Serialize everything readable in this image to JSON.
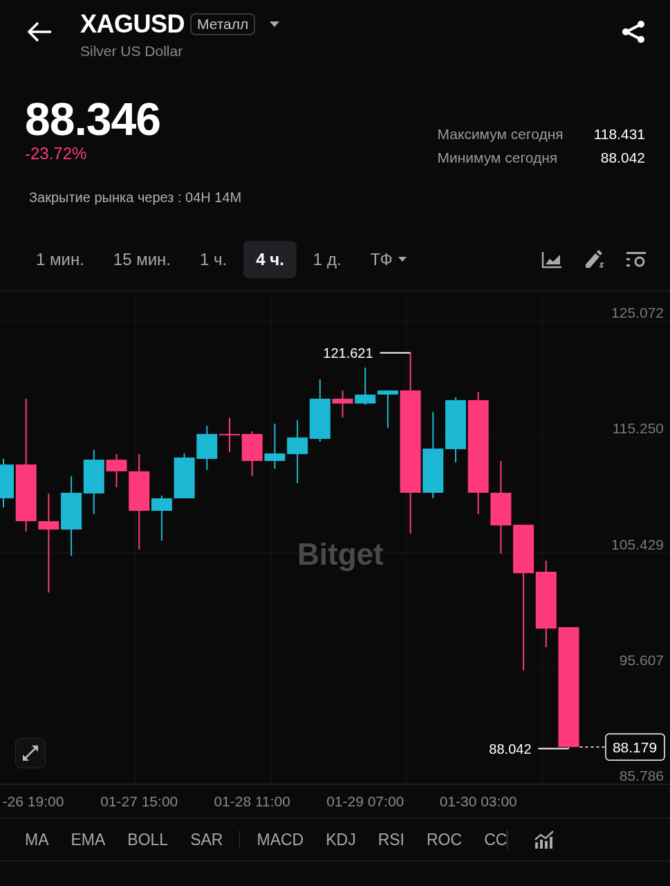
{
  "header": {
    "symbol": "XAGUSD",
    "badge": "Металл",
    "name": "Silver US Dollar"
  },
  "price": {
    "last": "88.346",
    "change": "-23.72%",
    "stats": [
      {
        "label": "Максимум сегодня",
        "value": "118.431"
      },
      {
        "label": "Минимум сегодня",
        "value": "88.042"
      }
    ],
    "market_close": "Закрытие рынка через : 04H 14M"
  },
  "timeframes": [
    {
      "label": "1 мин.",
      "selected": false
    },
    {
      "label": "15 мин.",
      "selected": false
    },
    {
      "label": "1 ч.",
      "selected": false
    },
    {
      "label": "4 ч.",
      "selected": true
    },
    {
      "label": "1 д.",
      "selected": false
    }
  ],
  "timeframe_menu": {
    "label": "ТФ"
  },
  "chart": {
    "watermark": "Bitget",
    "price_axis": [
      "125.072",
      "115.250",
      "105.429",
      "95.607",
      "85.786"
    ],
    "time_axis": [
      "-26 19:00",
      "01-27 15:00",
      "01-28 11:00",
      "01-29 07:00",
      "01-30 03:00"
    ],
    "high_label": "121.621",
    "low_label": "88.042",
    "last_price": "88.179"
  },
  "indicators": {
    "main": [
      "MA",
      "EMA",
      "BOLL",
      "SAR"
    ],
    "sub": [
      "MACD",
      "KDJ",
      "RSI",
      "ROC",
      "CC"
    ]
  }
}
